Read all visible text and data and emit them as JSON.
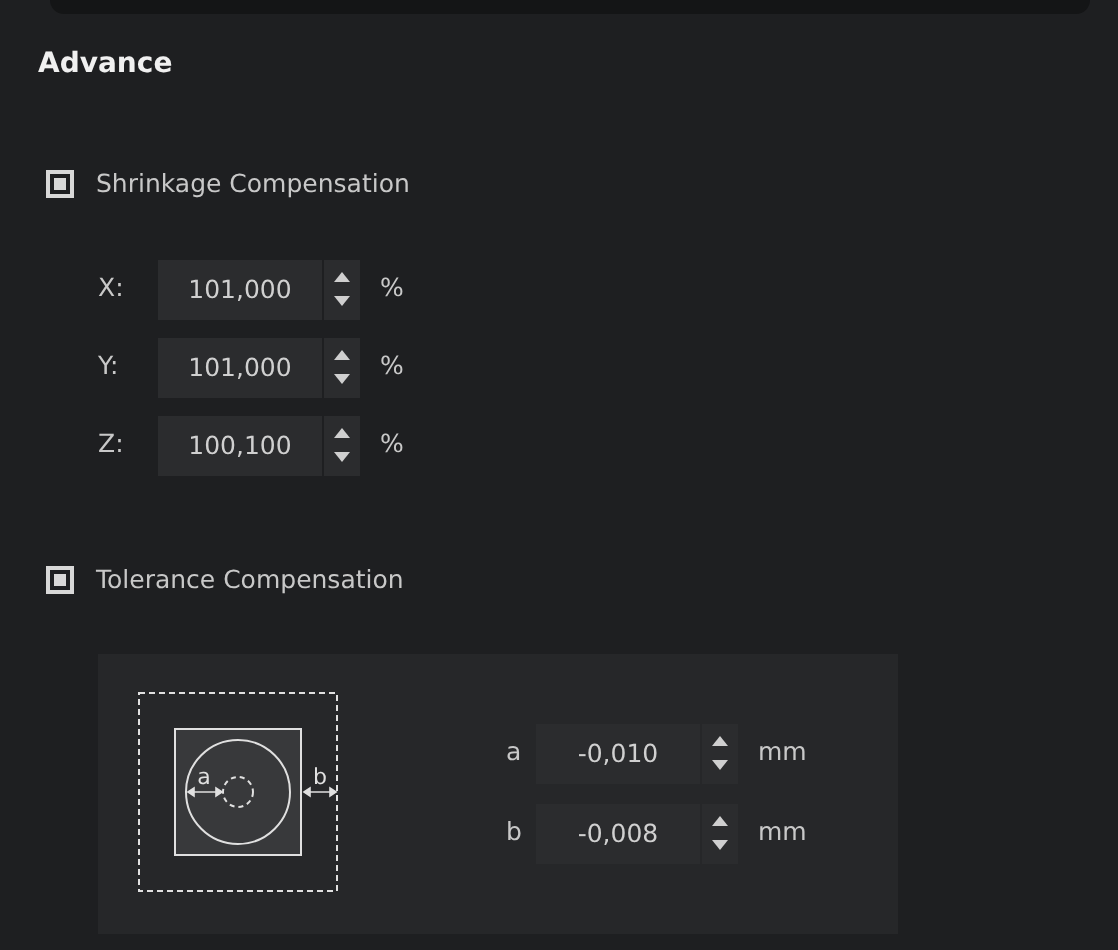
{
  "section_title": "Advance",
  "shrinkage": {
    "label": "Shrinkage Compensation",
    "checked": true,
    "rows": [
      {
        "axis": "X:",
        "value": "101,000",
        "unit": "%"
      },
      {
        "axis": "Y:",
        "value": "101,000",
        "unit": "%"
      },
      {
        "axis": "Z:",
        "value": "100,100",
        "unit": "%"
      }
    ]
  },
  "tolerance": {
    "label": "Tolerance Compensation",
    "checked": true,
    "diagram_labels": [
      "a",
      "b"
    ],
    "rows": [
      {
        "name": "a",
        "value": "-0,010",
        "unit": "mm"
      },
      {
        "name": "b",
        "value": "-0,008",
        "unit": "mm"
      }
    ]
  }
}
